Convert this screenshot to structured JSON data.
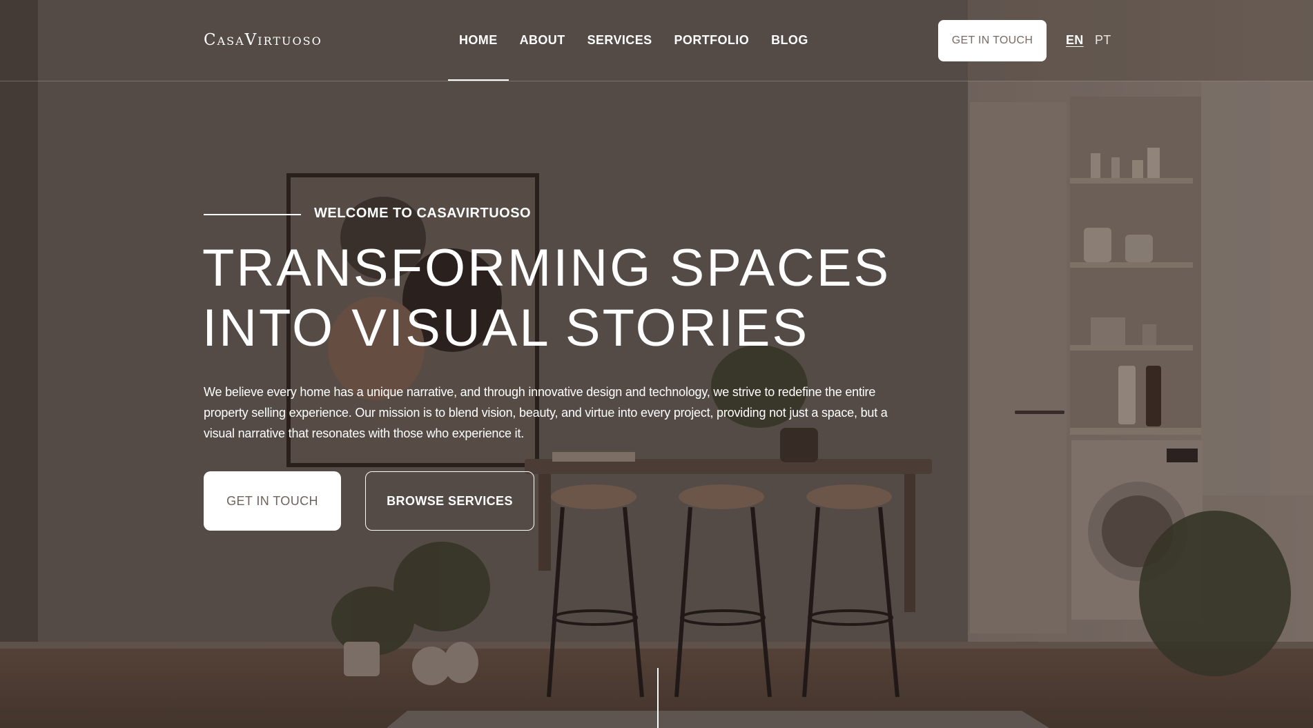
{
  "brand": {
    "logo": "CasaVirtuoso"
  },
  "nav": {
    "items": [
      {
        "label": "HOME",
        "active": true
      },
      {
        "label": "ABOUT",
        "active": false
      },
      {
        "label": "SERVICES",
        "active": false
      },
      {
        "label": "PORTFOLIO",
        "active": false
      },
      {
        "label": "BLOG",
        "active": false
      }
    ]
  },
  "header": {
    "cta_label": "GET IN TOUCH",
    "languages": [
      {
        "code": "EN",
        "active": true
      },
      {
        "code": "PT",
        "active": false
      }
    ]
  },
  "hero": {
    "eyebrow": "WELCOME TO CASAVIRTUOSO",
    "headline_line1": "TRANSFORMING SPACES",
    "headline_line2": "INTO VISUAL STORIES",
    "description": "We believe every home has a unique narrative, and through innovative design and technology, we strive to redefine the entire property selling experience. Our mission is to blend vision, beauty, and virtue into every project, providing not just a space, but a visual narrative that resonates with those who experience it.",
    "primary_button": "GET IN TOUCH",
    "secondary_button": "BROWSE SERVICES"
  },
  "colors": {
    "overlay": "#5a4d45",
    "text": "#ffffff",
    "primary_button_text": "#6e625a"
  },
  "icons": {
    "scroll_indicator": "scroll-line"
  }
}
